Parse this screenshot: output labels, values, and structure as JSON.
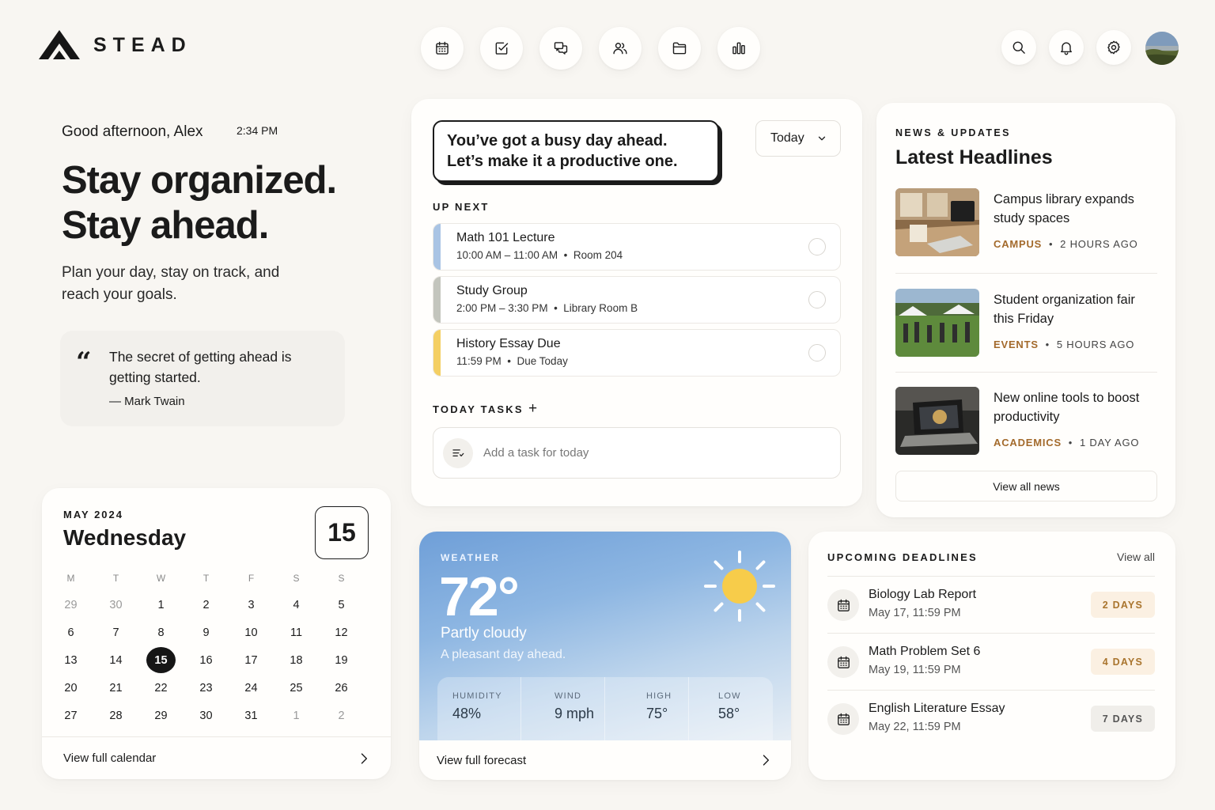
{
  "brand": {
    "name": "STEAD"
  },
  "nav": [
    {
      "icon": "calendar-icon"
    },
    {
      "icon": "checkbox-icon"
    },
    {
      "icon": "chat-icon"
    },
    {
      "icon": "users-icon"
    },
    {
      "icon": "folder-icon"
    },
    {
      "icon": "bar-chart-icon"
    }
  ],
  "tools": [
    {
      "icon": "search-icon"
    },
    {
      "icon": "bell-icon"
    },
    {
      "icon": "gear-icon"
    }
  ],
  "hero": {
    "greeting": "Good afternoon, Alex",
    "time": "2:34 PM",
    "title_line1": "Stay organized.",
    "title_line2": "Stay ahead.",
    "subtitle": "Plan your day, stay on track, and reach your goals.",
    "quote": "The secret of getting ahead is getting started.",
    "quote_author": "— Mark Twain"
  },
  "calendar": {
    "month": "MAY 2024",
    "weekday": "Wednesday",
    "day": "15",
    "headers": [
      "M",
      "T",
      "W",
      "T",
      "F",
      "S",
      "S"
    ],
    "days": [
      {
        "d": "29",
        "muted": true
      },
      {
        "d": "30",
        "muted": true
      },
      {
        "d": "1"
      },
      {
        "d": "2"
      },
      {
        "d": "3"
      },
      {
        "d": "4"
      },
      {
        "d": "5"
      },
      {
        "d": "6"
      },
      {
        "d": "7"
      },
      {
        "d": "8"
      },
      {
        "d": "9"
      },
      {
        "d": "10"
      },
      {
        "d": "11"
      },
      {
        "d": "12"
      },
      {
        "d": "13"
      },
      {
        "d": "14"
      },
      {
        "d": "15",
        "selected": true
      },
      {
        "d": "16"
      },
      {
        "d": "17"
      },
      {
        "d": "18"
      },
      {
        "d": "19"
      },
      {
        "d": "20"
      },
      {
        "d": "21"
      },
      {
        "d": "22"
      },
      {
        "d": "23"
      },
      {
        "d": "24"
      },
      {
        "d": "25"
      },
      {
        "d": "26"
      },
      {
        "d": "27"
      },
      {
        "d": "28"
      },
      {
        "d": "29"
      },
      {
        "d": "30"
      },
      {
        "d": "31"
      },
      {
        "d": "1",
        "muted": true
      },
      {
        "d": "2",
        "muted": true
      }
    ],
    "footer": "View full calendar"
  },
  "schedule": {
    "busy_line1": "You’ve got a busy day ahead.",
    "busy_line2": "Let’s make it a productive one.",
    "range": "Today",
    "up_next_label": "UP NEXT",
    "events": [
      {
        "title": "Math 101 Lecture",
        "time": "10:00 AM – 11:00 AM",
        "place": "Room 204",
        "color": "#a9c4e4"
      },
      {
        "title": "Study Group",
        "time": "2:00 PM – 3:30 PM",
        "place": "Library Room B",
        "color": "#c3c5bd"
      },
      {
        "title": "History Essay Due",
        "time": "11:59 PM",
        "place": "Due Today",
        "color": "#f4cf63"
      }
    ],
    "tasks_label": "TODAY TASKS",
    "tasks_add": "+",
    "task_placeholder": "Add a task for today"
  },
  "weather": {
    "label": "WEATHER",
    "temp": "72°",
    "condition": "Partly cloudy",
    "description": "A pleasant day ahead.",
    "stats": [
      {
        "label": "HUMIDITY",
        "value": "48%"
      },
      {
        "label": "WIND",
        "value": "9 mph"
      },
      {
        "label": "HIGH",
        "value": "75°"
      },
      {
        "label": "LOW",
        "value": "58°"
      }
    ],
    "footer": "View full forecast",
    "sun_color": "#f7cc4a"
  },
  "news": {
    "label": "NEWS & UPDATES",
    "title": "Latest Headlines",
    "items": [
      {
        "headline": "Campus library expands study spaces",
        "category": "CAMPUS",
        "age": "2 HOURS AGO"
      },
      {
        "headline": "Student organization fair this Friday",
        "category": "EVENTS",
        "age": "5 HOURS AGO"
      },
      {
        "headline": "New online tools to boost productivity",
        "category": "ACADEMICS",
        "age": "1 DAY AGO"
      }
    ],
    "view_all": "View all news"
  },
  "deadlines": {
    "label": "UPCOMING DEADLINES",
    "view_all": "View all",
    "items": [
      {
        "title": "Biology Lab Report",
        "date": "May 17, 11:59 PM",
        "badge": "2 DAYS",
        "badge_bg": "#fbf0e2",
        "badge_fg": "#a9742d"
      },
      {
        "title": "Math Problem Set 6",
        "date": "May 19, 11:59 PM",
        "badge": "4 DAYS",
        "badge_bg": "#fbf0e2",
        "badge_fg": "#a9742d"
      },
      {
        "title": "English Literature Essay",
        "date": "May 22, 11:59 PM",
        "badge": "7 DAYS",
        "badge_bg": "#f0eeea",
        "badge_fg": "#555555"
      }
    ]
  }
}
